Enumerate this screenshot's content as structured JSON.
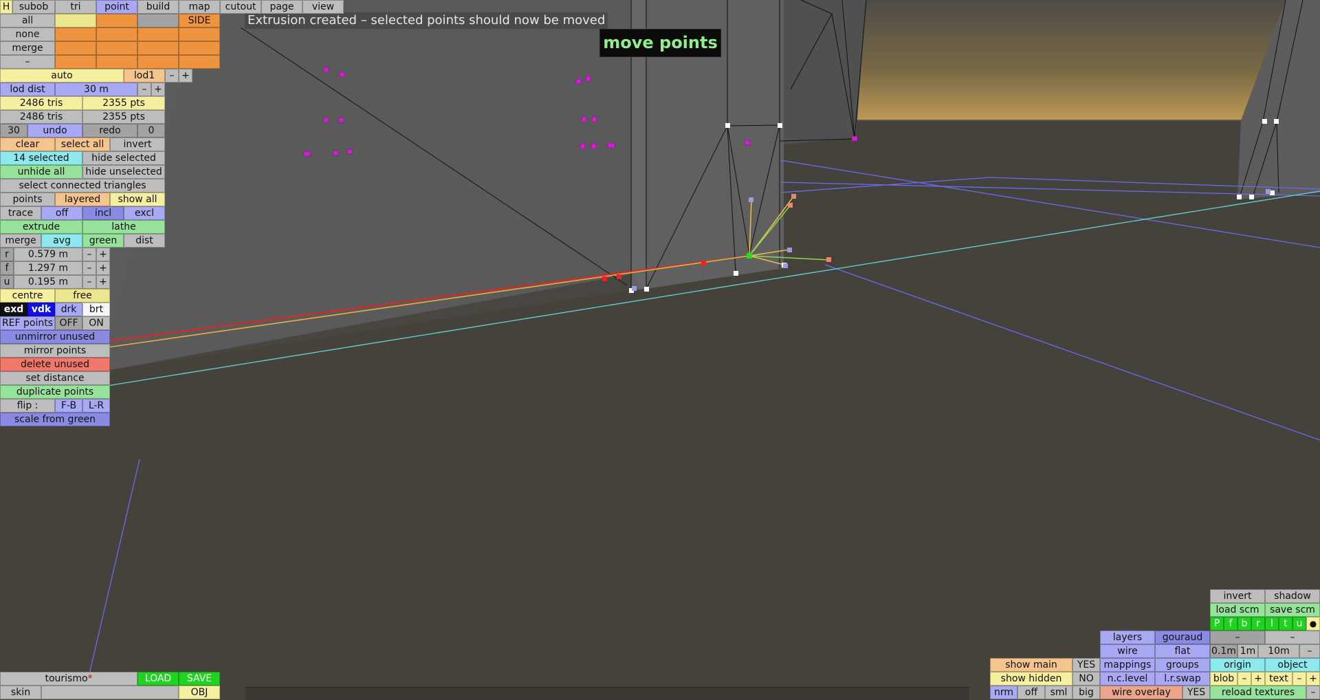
{
  "viewport": {
    "message": "Extrusion created – selected points should now be moved",
    "mode_label": "move points"
  },
  "tabs": {
    "h": "H",
    "subob": "subob",
    "tri": "tri",
    "point": "point",
    "build": "build",
    "map": "map",
    "cutout": "cutout",
    "page": "page",
    "view": "view"
  },
  "palette": {
    "all": "all",
    "none": "none",
    "merge": "merge",
    "dash": "–",
    "side": "SIDE"
  },
  "lod": {
    "auto": "auto",
    "lod1": "lod1",
    "minus": "–",
    "plus": "+",
    "dist_label": "lod dist",
    "dist_value": "30 m"
  },
  "stats": {
    "tris_1": "2486 tris",
    "pts_1": "2355 pts",
    "tris_2": "2486 tris",
    "pts_2": "2355 pts"
  },
  "history": {
    "undo_count": "30",
    "undo": "undo",
    "redo": "redo",
    "redo_count": "0"
  },
  "selection": {
    "clear": "clear",
    "select_all": "select all",
    "invert": "invert",
    "count": "14 selected",
    "hide_selected": "hide selected",
    "unhide_all": "unhide all",
    "hide_unselected": "hide unselected",
    "select_connected": "select connected triangles"
  },
  "display": {
    "points": "points",
    "layered": "layered",
    "show_all": "show all"
  },
  "trace": {
    "label": "trace",
    "off": "off",
    "incl": "incl",
    "excl": "excl"
  },
  "ops": {
    "extrude": "extrude",
    "lathe": "lathe",
    "merge": "merge",
    "avg": "avg",
    "green": "green",
    "dist": "dist"
  },
  "dims": {
    "r_label": "r",
    "r_value": "0.579 m",
    "f_label": "f",
    "f_value": "1.297 m",
    "u_label": "u",
    "u_value": "0.195 m",
    "minus": "–",
    "plus": "+"
  },
  "pivot": {
    "centre": "centre",
    "free": "free"
  },
  "shade": {
    "exd": "exd",
    "vdk": "vdk",
    "drk": "drk",
    "brt": "brt"
  },
  "refpoints": {
    "label": "REF points",
    "off": "OFF",
    "on": "ON"
  },
  "tools": {
    "unmirror_unused": "unmirror unused",
    "mirror_points": "mirror points",
    "delete_unused": "delete unused",
    "set_distance": "set distance",
    "duplicate_points": "duplicate points",
    "flip_label": "flip :",
    "flip_fb": "F-B",
    "flip_lr": "L-R",
    "scale_from_green": "scale from green"
  },
  "file": {
    "name": "tourismo",
    "modified_mark": "*",
    "load": "LOAD",
    "save": "SAVE",
    "skin": "skin",
    "obj": "OBJ"
  },
  "right_panel": {
    "invert": "invert",
    "shadow": "shadow",
    "load_scm": "load scm",
    "save_scm": "save scm",
    "views": [
      "P",
      "f",
      "b",
      "r",
      "l",
      "t",
      "u",
      "●"
    ],
    "dash": "–",
    "layers": "layers",
    "gouraud": "gouraud",
    "wire": "wire",
    "flat": "flat",
    "grid_01": "0.1m",
    "grid_1": "1m",
    "grid_10": "10m",
    "show_main": "show main",
    "show_main_val": "YES",
    "mappings": "mappings",
    "groups": "groups",
    "origin": "origin",
    "object": "object",
    "show_hidden": "show hidden",
    "show_hidden_val": "NO",
    "nc_level": "n.c.level",
    "lr_swap": "l.r.swap",
    "blob": "blob",
    "text": "text",
    "minus": "–",
    "plus": "+",
    "nrm": "nrm",
    "off": "off",
    "sml": "sml",
    "big": "big",
    "wire_overlay": "wire overlay",
    "wire_overlay_val": "YES",
    "reload_textures": "reload textures"
  }
}
